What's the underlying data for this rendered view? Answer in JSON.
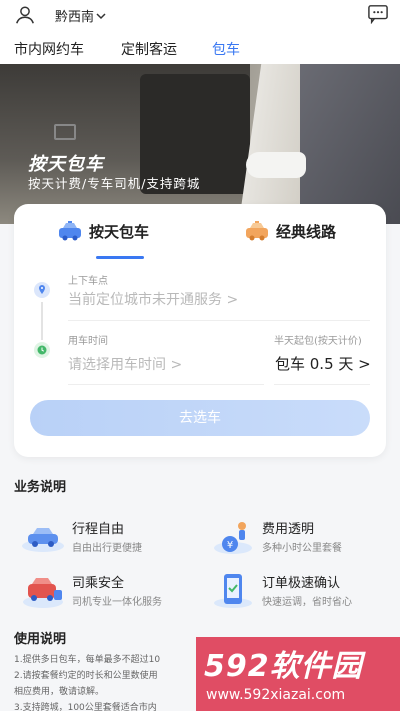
{
  "topbar": {
    "city": "黔西南",
    "user_icon": "user-icon",
    "message_icon": "message-icon"
  },
  "tabs": [
    {
      "label": "市内网约车",
      "active": false
    },
    {
      "label": "定制客运",
      "active": false
    },
    {
      "label": "包车",
      "active": true
    }
  ],
  "hero": {
    "title": "按天包车",
    "subtitle": "按天计费/专车司机/支持跨城"
  },
  "booking": {
    "modes": [
      {
        "label": "按天包车",
        "icon": "blue-car-icon",
        "active": true
      },
      {
        "label": "经典线路",
        "icon": "orange-taxi-icon",
        "active": false
      }
    ],
    "pickup_label": "上下车点",
    "pickup_value": "当前定位城市未开通服务 >",
    "time_label": "用车时间",
    "time_value": "请选择用车时间 >",
    "half_day_label": "半天起包(按天计价)",
    "days_value": "包车 0.5 天 >",
    "select_button": "去选车"
  },
  "business": {
    "title": "业务说明",
    "features": [
      {
        "name": "行程自由",
        "desc": "自由出行更便捷",
        "icon": "car-road-icon"
      },
      {
        "name": "费用透明",
        "desc": "多种小时公里套餐",
        "icon": "coin-people-icon"
      },
      {
        "name": "司乘安全",
        "desc": "司机专业一体化服务",
        "icon": "safety-car-icon"
      },
      {
        "name": "订单极速确认",
        "desc": "快速运调，省时省心",
        "icon": "phone-confirm-icon"
      }
    ]
  },
  "usage": {
    "title": "使用说明",
    "lines": [
      "1.提供多日包车，每单最多不超过10",
      "2.请按套餐约定的时长和公里数使用",
      "相应费用，敬请谅解。",
      "3.支持跨城，100公里套餐适合市内"
    ]
  },
  "watermark": {
    "brand": "592软件园",
    "url": "www.592xiazai.com"
  },
  "colors": {
    "accent": "#3a78f2",
    "button_bg": "#c3d8f8",
    "watermark": "#de4058"
  }
}
